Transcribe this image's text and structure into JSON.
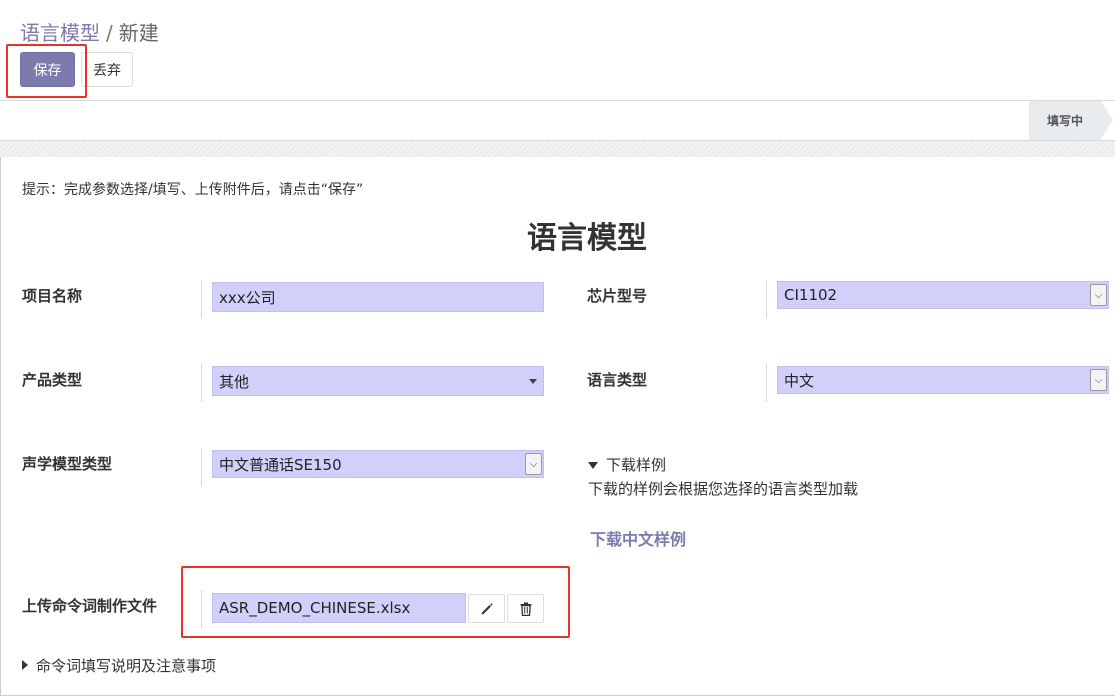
{
  "breadcrumb": {
    "parent": "语言模型",
    "separator": "/",
    "current": "新建"
  },
  "toolbar": {
    "save_label": "保存",
    "discard_label": "丢弃"
  },
  "statusbar": {
    "stage": "填写中"
  },
  "form": {
    "hint": "提示：完成参数选择/填写、上传附件后，请点击“保存”",
    "title": "语言模型",
    "project_name": {
      "label": "项目名称",
      "value": "xxx公司"
    },
    "chip_model": {
      "label": "芯片型号",
      "value": "CI1102"
    },
    "product_type": {
      "label": "产品类型",
      "value": "其他"
    },
    "language_type": {
      "label": "语言类型",
      "value": "中文"
    },
    "acoustic_model": {
      "label": "声学模型类型",
      "value": "中文普通话SE150"
    },
    "sample": {
      "toggle": "下载样例",
      "description": "下载的样例会根据您选择的语言类型加载",
      "link": "下载中文样例"
    },
    "upload": {
      "label": "上传命令词制作文件",
      "filename": "ASR_DEMO_CHINESE.xlsx"
    },
    "notes_toggle": "命令词填写说明及注意事项"
  },
  "colors": {
    "accent": "#7c7bad",
    "input_bg": "#d0d0fb",
    "highlight": "#e8322a"
  },
  "icons": {
    "edit": "pencil-icon",
    "delete": "trash-icon"
  }
}
